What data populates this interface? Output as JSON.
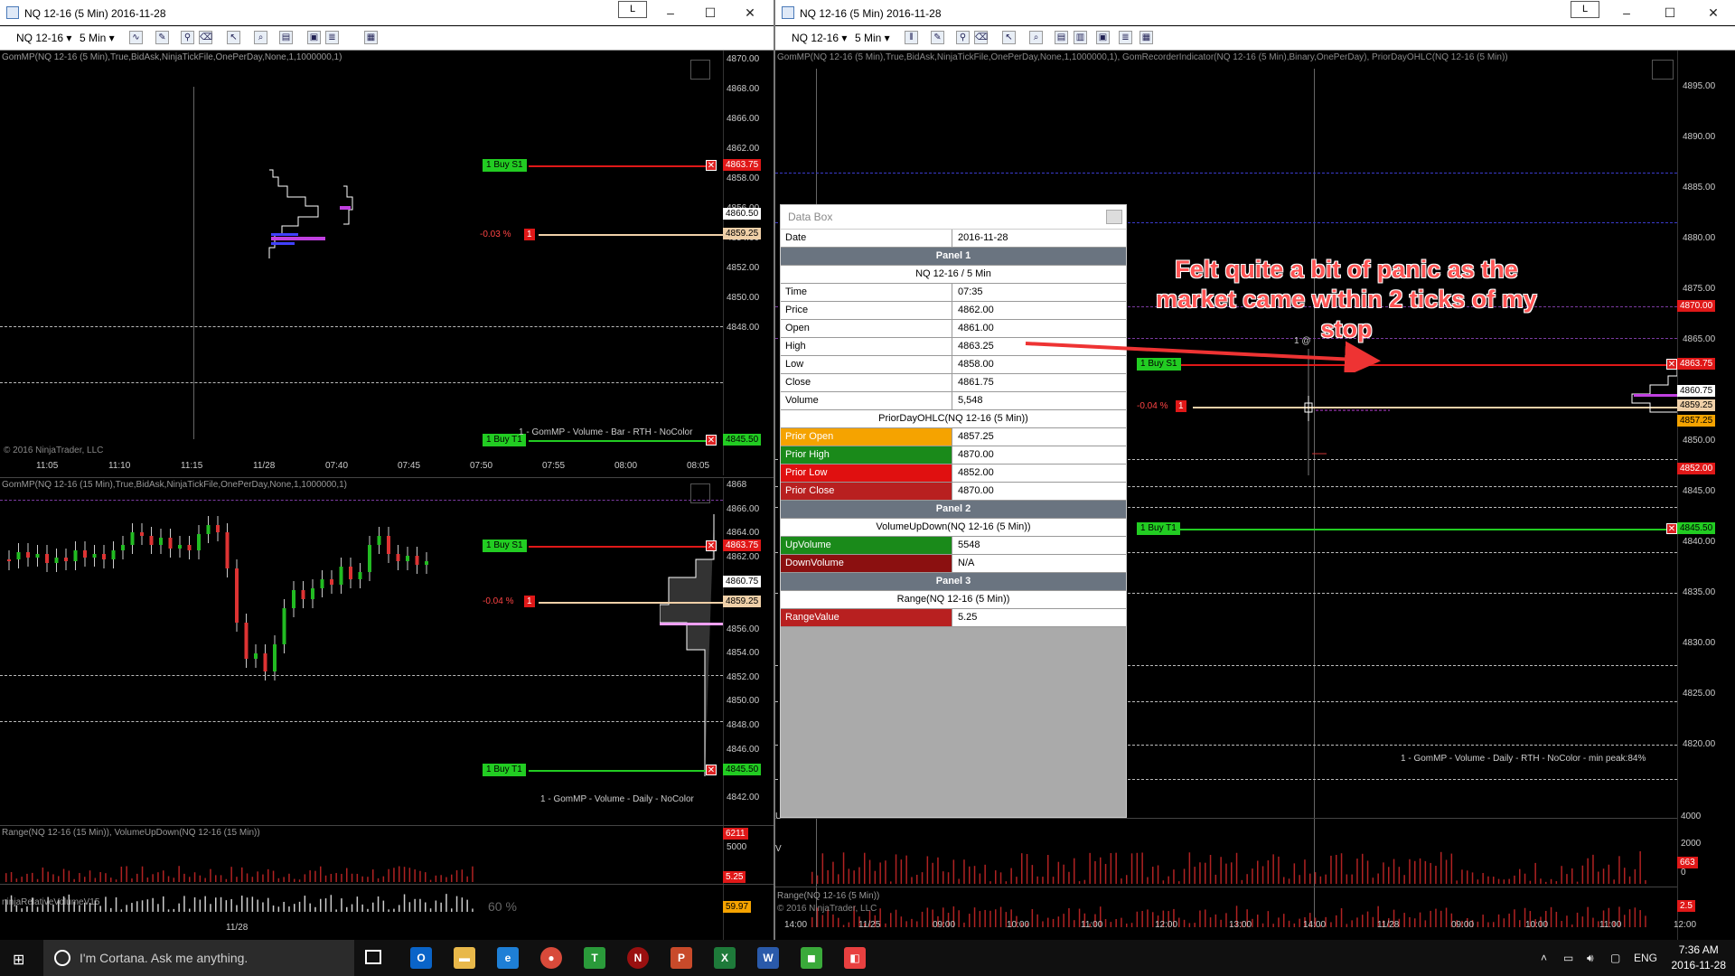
{
  "left_window": {
    "title": "NQ 12-16 (5 Min)  2016-11-28",
    "l_button": "L",
    "instrument": "NQ 12-16",
    "interval": "5 Min",
    "top_chart": {
      "indicator": "GomMP(NQ 12-16 (5 Min),True,BidAsk,NinjaTickFile,OnePerDay,None,1,1000000,1)",
      "prices": [
        "4870.00",
        "4868.00",
        "4866.00",
        "4862.00",
        "4858.00",
        "4856.00",
        "4854.00",
        "4852.00",
        "4850.00",
        "4848.00"
      ],
      "badge_buy": "4863.75",
      "badge_mid1": "4860.50",
      "badge_last": "4859.25",
      "badge_t1": "4845.50",
      "times": [
        "11:05",
        "11:10",
        "11:15",
        "11/28",
        "07:40",
        "07:45",
        "07:50",
        "07:55",
        "08:00",
        "08:05"
      ],
      "copyright": "© 2016 NinjaTrader, LLC",
      "gom_label": "1 - GomMP - Volume - Bar - RTH - NoColor",
      "pct": "-0.03 %",
      "pct_qty": "1"
    },
    "mid_chart": {
      "indicator": "GomMP(NQ 12-16 (15 Min),True,BidAsk,NinjaTickFile,OnePerDay,None,1,1000000,1)",
      "prices": [
        "4868",
        "4866.00",
        "4864.00",
        "4862.00",
        "4860.00",
        "4858.00",
        "4856.00",
        "4854.00",
        "4852.00",
        "4850.00",
        "4848.00",
        "4846.00",
        "4844.00",
        "4842.00"
      ],
      "badge_buy": "4863.75",
      "badge_mid": "4860.75",
      "badge_last": "4859.25",
      "badge_t1": "4845.50",
      "gom_label": "1 - GomMP - Volume - Daily - NoColor",
      "pct": "-0.04 %",
      "pct_qty": "1"
    },
    "range_panel": {
      "indicator": "Range(NQ 12-16 (15 Min)), VolumeUpDown(NQ 12-16 (15 Min))",
      "badge_top": "6211",
      "axis_val": "5000",
      "badge_range": "5.25"
    },
    "rel_panel": {
      "indicator": "ninjaRelativeVolumeV15",
      "pct": "60 %",
      "badge": "59.97",
      "date": "11/28"
    }
  },
  "right_window": {
    "title": "NQ 12-16 (5 Min)  2016-11-28",
    "l_button": "L",
    "instrument": "NQ 12-16",
    "interval": "5 Min",
    "indicator": "GomMP(NQ 12-16 (5 Min),True,BidAsk,NinjaTickFile,OnePerDay,None,1,1000000,1), GomRecorderIndicator(NQ 12-16 (5 Min),Binary,OnePerDay), PriorDayOHLC(NQ 12-16 (5 Min))",
    "prices": [
      "4895.00",
      "4890.00",
      "4885.00",
      "4880.00",
      "4875.00",
      "4865.00",
      "4855.00",
      "4850.00",
      "4845.00",
      "4840.00",
      "4835.00",
      "4830.00",
      "4825.00",
      "4820.00"
    ],
    "badge_prior_high": "4870.00",
    "badge_buy": "4863.75",
    "badge_mid": "4860.75",
    "badge_last": "4859.25",
    "badge_open": "4857.25",
    "badge_low": "4852.00",
    "badge_t1": "4845.50",
    "pct": "-0.04 %",
    "pct_qty": "1",
    "gom_label": "1 - GomMP - Volume - Daily - RTH - NoColor - min peak:84%",
    "fill_note": "1 @",
    "vol_axis": [
      "4000",
      "2000",
      "0"
    ],
    "badge_vol": "663",
    "badge_range": "2.5",
    "range_label": "Range(NQ 12-16 (5 Min))",
    "copyright": "© 2016 NinjaTrader, LLC",
    "times": [
      "14:00",
      "11/25",
      "09:00",
      "10:00",
      "11:00",
      "12:00",
      "13:00",
      "14:00",
      "11/28",
      "09:00",
      "10:00",
      "11:00",
      "12:00"
    ],
    "left_edge_marks": [
      "U",
      "V"
    ]
  },
  "orders": {
    "buy_stop": "1 Buy S1",
    "buy_target": "1 Buy T1"
  },
  "data_box": {
    "title": "Data Box",
    "date_label": "Date",
    "date_value": "2016-11-28",
    "panel1": "Panel 1",
    "panel1_sub": "NQ 12-16 / 5 Min",
    "rows1": [
      {
        "k": "Time",
        "v": "07:35"
      },
      {
        "k": "Price",
        "v": "4862.00"
      },
      {
        "k": "Open",
        "v": "4861.00"
      },
      {
        "k": "High",
        "v": "4863.25"
      },
      {
        "k": "Low",
        "v": "4858.00"
      },
      {
        "k": "Close",
        "v": "4861.75"
      },
      {
        "k": "Volume",
        "v": "5,548"
      }
    ],
    "ohlc_sub": "PriorDayOHLC(NQ 12-16 (5 Min))",
    "rows_ohlc": [
      {
        "k": "Prior Open",
        "v": "4857.25",
        "c": "#f5a300"
      },
      {
        "k": "Prior High",
        "v": "4870.00",
        "c": "#1a8a1a"
      },
      {
        "k": "Prior Low",
        "v": "4852.00",
        "c": "#e01010"
      },
      {
        "k": "Prior Close",
        "v": "4870.00",
        "c": "#b82020"
      }
    ],
    "panel2": "Panel 2",
    "panel2_sub": "VolumeUpDown(NQ 12-16 (5 Min))",
    "rows2": [
      {
        "k": "UpVolume",
        "v": "5548",
        "c": "#1a8a1a"
      },
      {
        "k": "DownVolume",
        "v": "N/A",
        "c": "#8b1010"
      }
    ],
    "panel3": "Panel 3",
    "panel3_sub": "Range(NQ 12-16 (5 Min))",
    "rows3": [
      {
        "k": "RangeValue",
        "v": "5.25",
        "c": "#b82020"
      }
    ]
  },
  "annotation": "Felt quite a bit of panic as the market came within 2 ticks of my stop",
  "taskbar": {
    "search_placeholder": "I'm Cortana. Ask me anything.",
    "language": "ENG",
    "time": "7:36 AM",
    "date": "2016-11-28"
  },
  "colors": {
    "buy_stop_line": "#e01818",
    "target_line": "#22cc22",
    "last_line": "#f0d0a8",
    "annotation": "#ff5555",
    "order_green": "#22cc22"
  }
}
